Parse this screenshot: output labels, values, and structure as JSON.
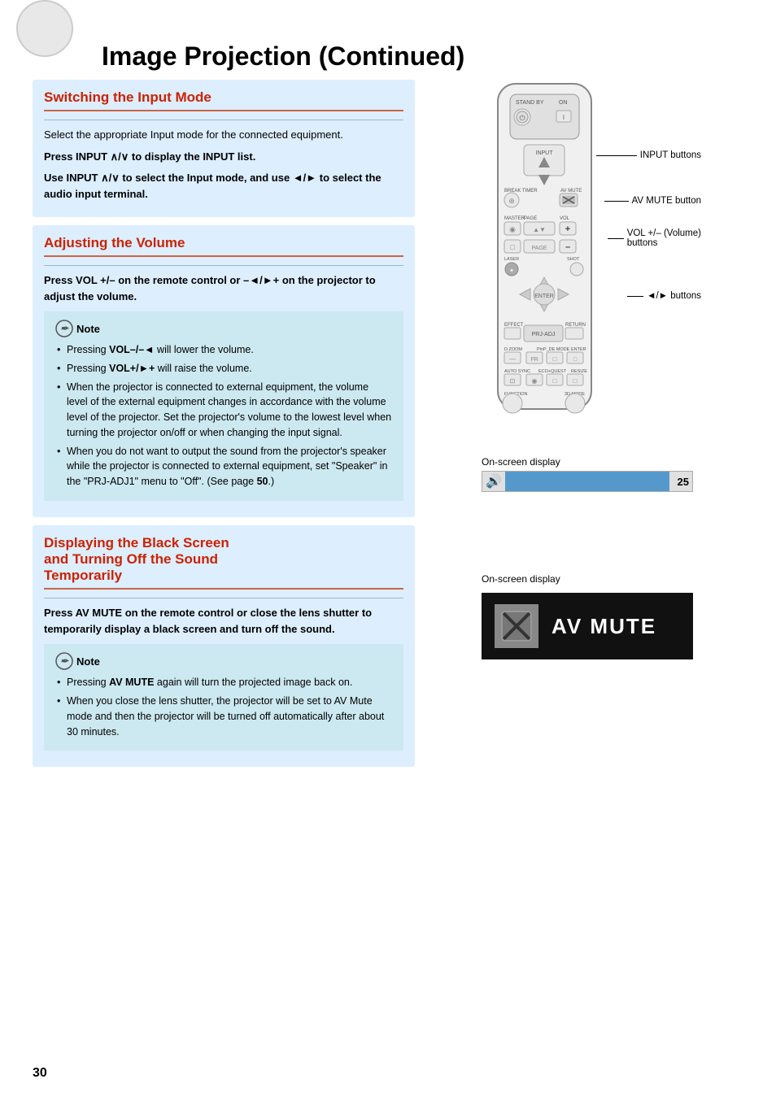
{
  "page": {
    "title": "Image Projection (Continued)",
    "page_number": "30"
  },
  "sections": {
    "switching_input": {
      "heading": "Switching the Input Mode",
      "body1": "Select the appropriate Input mode for the connected equipment.",
      "bold1": "Press INPUT ∧/∨ to display the INPUT list.",
      "bold2": "Use INPUT ∧/∨ to select the Input mode, and use ◄/► to select the audio input terminal.",
      "labels": {
        "input_buttons": "INPUT buttons",
        "av_mute_button": "AV MUTE button",
        "vol_buttons": "VOL +/– (Volume) buttons",
        "arrow_buttons": "◄/► buttons"
      }
    },
    "adjusting_volume": {
      "heading": "Adjusting the Volume",
      "bold_para": "Press VOL +/– on the remote control or –◄/►+ on the projector to adjust the volume.",
      "note_header": "Note",
      "notes": [
        "Pressing VOL–/–◄ will lower the volume.",
        "Pressing VOL+/►+ will raise the volume.",
        "When the projector is connected to external equipment, the volume level of the external equipment changes in accordance with the volume level of the projector. Set the projector's volume to the lowest level when turning the projector on/off or when changing the input signal.",
        "When you do not want to output the sound from the projector's speaker while the projector is connected to external equipment, set \"Speaker\" in the \"PRJ-ADJ1\" menu to \"Off\". (See page 50.)"
      ],
      "volume_display": {
        "label": "On-screen display",
        "value": 25
      }
    },
    "black_screen": {
      "heading": "Displaying the Black Screen and Turning Off the Sound Temporarily",
      "bold_para": "Press AV MUTE on the remote control or close the lens shutter to temporarily display a black screen and turn off the sound.",
      "note_header": "Note",
      "notes": [
        "Pressing AV MUTE again will turn the projected image back on.",
        "When you close the lens shutter, the projector will be set to AV Mute mode and then the projector will be turned off automatically after about 30 minutes."
      ],
      "av_mute_display": {
        "label": "On-screen display",
        "text": "AV MUTE"
      }
    }
  }
}
